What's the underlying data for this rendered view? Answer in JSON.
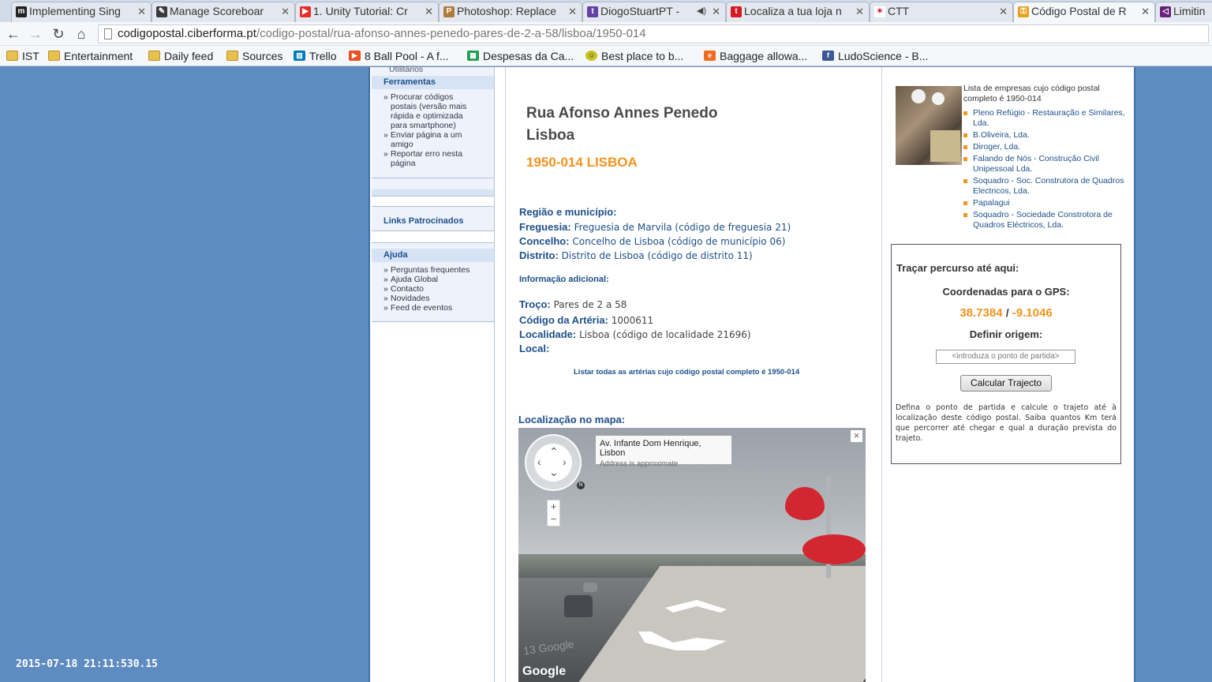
{
  "browser": {
    "tabs": [
      {
        "label": "Implementing Sing",
        "icon": "m-icon",
        "color": "#222222"
      },
      {
        "label": "Manage Scoreboar",
        "icon": "scoreboard-icon",
        "color": "#3a3a3a"
      },
      {
        "label": "1. Unity Tutorial: Cr",
        "icon": "youtube-icon",
        "color": "#e52d27"
      },
      {
        "label": "Photoshop: Replace",
        "icon": "photoshop-icon",
        "color": "#b07b3a"
      },
      {
        "label": "DiogoStuartPT -",
        "icon": "twitch-icon",
        "color": "#6441a5"
      },
      {
        "label": "Localiza a tua loja n",
        "icon": "t-icon",
        "color": "#d71921"
      },
      {
        "label": "CTT",
        "icon": "ctt-icon",
        "color": "#d71921"
      },
      {
        "label": "Código Postal de R",
        "icon": "key-icon",
        "color": "#e5a11c"
      },
      {
        "label": "Limitin",
        "icon": "vs-icon",
        "color": "#68217a"
      }
    ],
    "url_host": "codigopostal.ciberforma.pt",
    "url_path": "/codigo-postal/rua-afonso-annes-penedo-pares-de-2-a-58/lisboa/1950-014",
    "bookmarks": [
      {
        "label": "IST",
        "icon": "folder-icon"
      },
      {
        "label": "Entertainment",
        "icon": "folder-icon"
      },
      {
        "label": "Daily feed",
        "icon": "folder-icon"
      },
      {
        "label": "Sources",
        "icon": "folder-icon"
      },
      {
        "label": "Trello",
        "icon": "trello-icon"
      },
      {
        "label": "8 Ball Pool - A f...",
        "icon": "play-icon"
      },
      {
        "label": "Despesas da Ca...",
        "icon": "sheets-icon"
      },
      {
        "label": "Best place to b...",
        "icon": "smiley-icon"
      },
      {
        "label": "Baggage allowa...",
        "icon": "e-icon"
      },
      {
        "label": "LudoScience - B...",
        "icon": "facebook-icon"
      }
    ]
  },
  "sidebar": {
    "top_label": "Utilitários",
    "ferramentas_title": "Ferramentas",
    "ferramentas_items": [
      "Procurar códigos postais (versão mais rápida e optimizada para smartphone)",
      "Enviar página a um amigo",
      "Reportar erro nesta página"
    ],
    "links_title": "Links Patrocinados",
    "ajuda_title": "Ajuda",
    "ajuda_items": [
      "Perguntas frequentes",
      "Ajuda Global",
      "Contacto",
      "Novidades",
      "Feed de eventos"
    ]
  },
  "main": {
    "street_line1": "Rua Afonso Annes Penedo",
    "street_line2": "Lisboa",
    "postal_code": "1950-014 LISBOA",
    "region_title": "Região e município:",
    "freguesia_key": "Freguesia:",
    "freguesia_val": "Freguesia de Marvila (código de freguesia 21)",
    "concelho_key": "Concelho:",
    "concelho_val": "Concelho de Lisboa (código de município 06)",
    "distrito_key": "Distrito:",
    "distrito_val": "Distrito de Lisboa (código de distrito 11)",
    "info_title": "Informação adicional:",
    "troco_key": "Troço:",
    "troco_val": "Pares de 2 a 58",
    "arteria_key": "Código da Artéria:",
    "arteria_val": "1000611",
    "localidade_key": "Localidade:",
    "localidade_val": "Lisboa (código de localidade 21696)",
    "local_key": "Local:",
    "list_link": "Listar todas as artérias cujo código postal completo é 1950-014",
    "map_label": "Localização no mapa:",
    "streetview": {
      "address": "Av. Infante Dom Henrique, Lisbon",
      "approx": "Address is approximate",
      "close": "×",
      "zoom_in": "+",
      "zoom_out": "−",
      "compass_n": "N",
      "watermark": "Google",
      "watermark_faint": "13 Google"
    }
  },
  "ads": {
    "desc": "Lista de empresas cujo código postal completo é 1950-014",
    "items": [
      "Pleno Refúgio - Restauração e Similares, Lda.",
      "B.Oliveira, Lda.",
      "Diroger, Lda.",
      "Falando de Nós - Construção Civil Unipessoal Lda.",
      "Soquadro - Soc. Construtora de Quadros Electricos, Lda.",
      "Papalagui",
      "Soquadro - Sociedade Constrotora de Quadros Eléctricos, Lda."
    ]
  },
  "route": {
    "title": "Traçar percurso até aqui:",
    "gps_label": "Coordenadas para o GPS:",
    "lat": "38.7384",
    "sep": "/",
    "lon": "-9.1046",
    "origin_label": "Definir origem:",
    "origin_placeholder": "<introduza o ponto de partida>",
    "button": "Calcular Trajecto",
    "help": "Defina o ponto de partida e calcule o trajeto até à localização deste código postal. Saiba quantos Km terá que percorrer até chegar e qual a duração prevista do trajeto."
  },
  "overlay": {
    "timestamp": "2015-07-18 21:11:530.15"
  }
}
